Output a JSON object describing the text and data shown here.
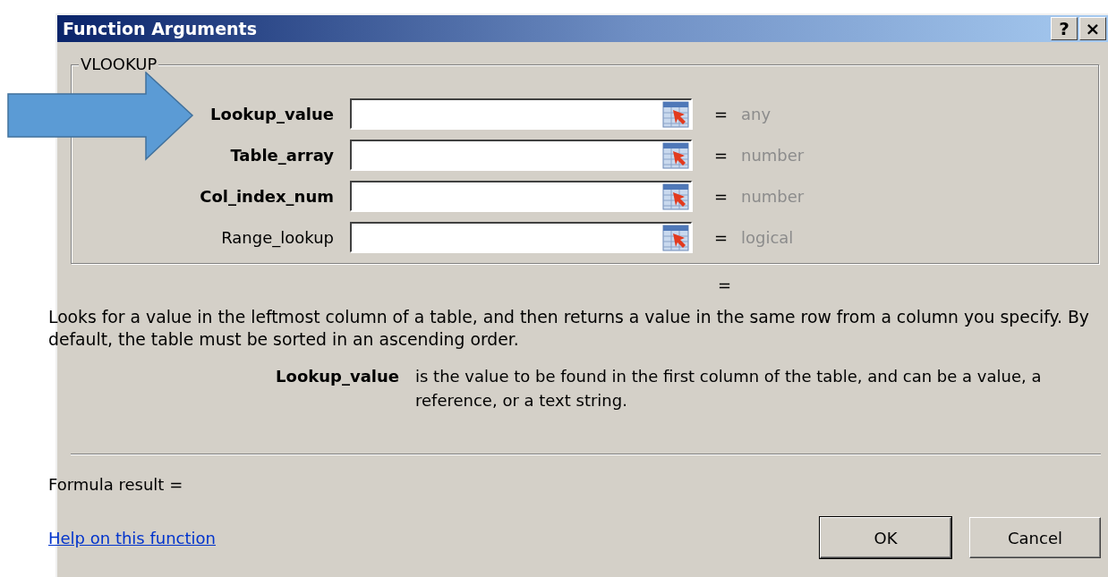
{
  "window": {
    "title": "Function Arguments",
    "buttons": [
      "?",
      "×"
    ]
  },
  "function_name": "VLOOKUP",
  "arguments": [
    {
      "name": "Lookup_value",
      "required": true,
      "equals": "=",
      "type": "any"
    },
    {
      "name": "Table_array",
      "required": true,
      "equals": "=",
      "type": "number"
    },
    {
      "name": "Col_index_num",
      "required": true,
      "equals": "=",
      "type": "number"
    },
    {
      "name": "Range_lookup",
      "required": false,
      "equals": "=",
      "type": "logical"
    }
  ],
  "result_equals": "=",
  "description": "Looks for a value in the leftmost column of a table, and then returns a value in the same row from a column you specify. By default, the table must be sorted in an ascending order.",
  "argument_help": {
    "name": "Lookup_value",
    "text": "is the value to be found in the first column of the table, and can be a value, a reference, or a text string."
  },
  "formula_result": "Formula result =",
  "help_link": "Help on this function",
  "buttons": [
    "OK",
    "Cancel"
  ]
}
